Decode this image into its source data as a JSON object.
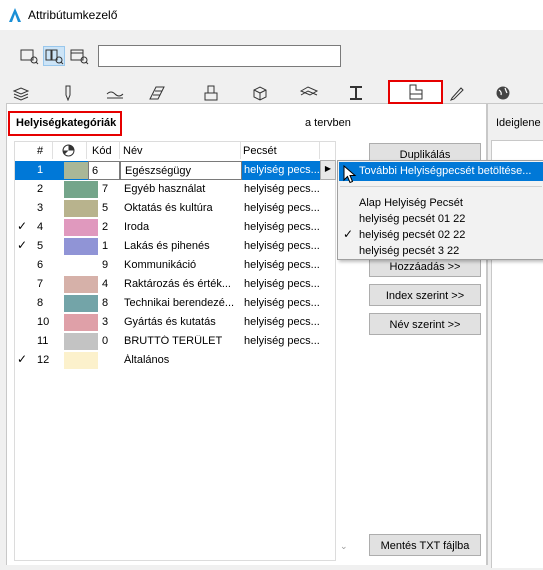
{
  "window": {
    "title": "Attribútumkezelő"
  },
  "toolbar": {
    "buttons": [
      {
        "icon": "list-view-icon",
        "active": false
      },
      {
        "icon": "grid-view-icon",
        "active": true
      },
      {
        "icon": "detail-view-icon",
        "active": false
      }
    ],
    "search_value": ""
  },
  "tabs": [
    {
      "icon": "layers-icon"
    },
    {
      "icon": "pen-icon"
    },
    {
      "icon": "line-types-icon"
    },
    {
      "icon": "fill-types-icon"
    },
    {
      "icon": "composites-icon"
    },
    {
      "icon": "surfaces-icon"
    },
    {
      "icon": "profiles-icon"
    },
    {
      "icon": "zone-categories-icon",
      "active": true
    },
    {
      "icon": "markup-icon"
    },
    {
      "icon": "globe-icon"
    }
  ],
  "section": {
    "title": "Helyiségkategóriák",
    "in_plan_label": "a tervben",
    "temporary_label": "Ideiglene"
  },
  "table": {
    "headers": {
      "num": "#",
      "kod": "Kód",
      "nev": "Név",
      "pecset": "Pecsét"
    },
    "rows": [
      {
        "check": "",
        "num": "1",
        "color": "#a9b797",
        "kod": "6",
        "nev": "Egészségügy",
        "pecset": "helyiség pecs...",
        "selected": true
      },
      {
        "check": "",
        "num": "2",
        "color": "#74a58a",
        "kod": "7",
        "nev": "Egyéb használat",
        "pecset": "helyiség pecs...",
        "selected": false
      },
      {
        "check": "",
        "num": "3",
        "color": "#b8b38d",
        "kod": "5",
        "nev": "Oktatás és kultúra",
        "pecset": "helyiség pecs...",
        "selected": false
      },
      {
        "check": "✓",
        "num": "4",
        "color": "#e099be",
        "kod": "2",
        "nev": "Iroda",
        "pecset": "helyiség pecs...",
        "selected": false
      },
      {
        "check": "✓",
        "num": "5",
        "color": "#9094d6",
        "kod": "1",
        "nev": "Lakás és pihenés",
        "pecset": "helyiség pecs...",
        "selected": false
      },
      {
        "check": "",
        "num": "6",
        "color": "",
        "kod": "9",
        "nev": "Kommunikáció",
        "pecset": "helyiség pecs...",
        "selected": false
      },
      {
        "check": "",
        "num": "7",
        "color": "#d6b1a9",
        "kod": "4",
        "nev": "Raktározás és érték...",
        "pecset": "helyiség pecs...",
        "selected": false
      },
      {
        "check": "",
        "num": "8",
        "color": "#73a4a8",
        "kod": "8",
        "nev": "Technikai berendezé...",
        "pecset": "helyiség pecs...",
        "selected": false
      },
      {
        "check": "",
        "num": "10",
        "color": "#dfa0a8",
        "kod": "3",
        "nev": "Gyártás és kutatás",
        "pecset": "helyiség pecs...",
        "selected": false
      },
      {
        "check": "",
        "num": "11",
        "color": "#c3c3c3",
        "kod": "0",
        "nev": "BRUTTÓ TERÜLET",
        "pecset": "helyiség pecs...",
        "selected": false
      },
      {
        "check": "✓",
        "num": "12",
        "color": "#fcf1cc",
        "kod": "",
        "nev": "Általános",
        "pecset": "helyiség pecs...",
        "selected": false
      }
    ]
  },
  "buttons": {
    "duplicate": "Duplikálás",
    "add": "Hozzáadás >>",
    "by_index": "Index szerint >>",
    "by_name": "Név szerint >>",
    "save_txt": "Mentés TXT fájlba"
  },
  "popup_menu": {
    "items": [
      {
        "label": "További Helyiségpecsét betöltése...",
        "highlighted": true,
        "checked": false
      },
      {
        "label": "Alap Helyiség Pecsét",
        "highlighted": false,
        "checked": false
      },
      {
        "label": "helyiség pecsét 01 22",
        "highlighted": false,
        "checked": false
      },
      {
        "label": "helyiség pecsét 02 22",
        "highlighted": false,
        "checked": true
      },
      {
        "label": "helyiség pecsét 3 22",
        "highlighted": false,
        "checked": false
      }
    ]
  }
}
